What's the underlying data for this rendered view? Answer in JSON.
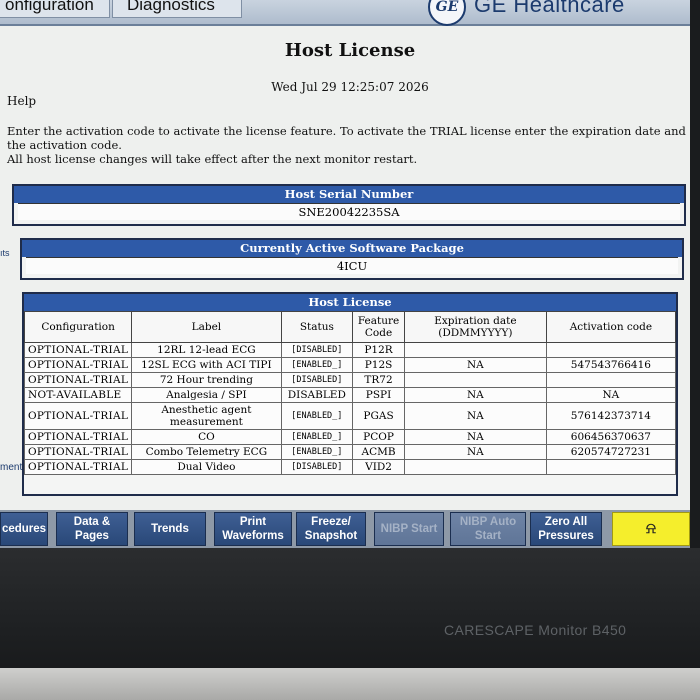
{
  "tabs": [
    {
      "label": "onfiguration"
    },
    {
      "label": "Diagnostics"
    }
  ],
  "brand": {
    "logo": "GE",
    "name": "GE Healthcare"
  },
  "page": {
    "title": "Host License",
    "datetime": "Wed Jul 29 12:25:07 2026",
    "help_label": "Help",
    "instructions": [
      "Enter the activation code to activate the license feature. To activate the TRIAL license enter the expiration date and",
      "the activation code.",
      "All host license changes will take effect after the next monitor restart."
    ]
  },
  "serial": {
    "header": "Host Serial Number",
    "value": "SNE20042235SA"
  },
  "package": {
    "header": "Currently Active Software Package",
    "value": "4ICU"
  },
  "side_labels": {
    "left_1": "ıts",
    "left_2": "ment"
  },
  "license_table": {
    "header": "Host License",
    "columns": [
      "Configuration",
      "Label",
      "Status",
      "Feature Code",
      "Expiration date (DDMMYYYY)",
      "Activation code"
    ],
    "rows": [
      {
        "config": "OPTIONAL-TRIAL",
        "label": "12RL 12-lead ECG",
        "status": "[DISABLED]",
        "code": "P12R",
        "expiration": "",
        "activation": ""
      },
      {
        "config": "OPTIONAL-TRIAL",
        "label": "12SL ECG with ACI TIPI",
        "status": "[ENABLED_]",
        "code": "P12S",
        "expiration": "NA",
        "activation": "547543766416"
      },
      {
        "config": "OPTIONAL-TRIAL",
        "label": "72 Hour trending",
        "status": "[DISABLED]",
        "code": "TR72",
        "expiration": "",
        "activation": ""
      },
      {
        "config": "NOT-AVAILABLE",
        "label": "Analgesia / SPI",
        "status": "DISABLED",
        "code": "PSPI",
        "expiration": "NA",
        "activation": "NA"
      },
      {
        "config": "OPTIONAL-TRIAL",
        "label": "Anesthetic agent measurement",
        "status": "[ENABLED_]",
        "code": "PGAS",
        "expiration": "NA",
        "activation": "576142373714"
      },
      {
        "config": "OPTIONAL-TRIAL",
        "label": "CO",
        "status": "[ENABLED_]",
        "code": "PCOP",
        "expiration": "NA",
        "activation": "606456370637"
      },
      {
        "config": "OPTIONAL-TRIAL",
        "label": "Combo Telemetry ECG",
        "status": "[ENABLED_]",
        "code": "ACMB",
        "expiration": "NA",
        "activation": "620574727231"
      },
      {
        "config": "OPTIONAL-TRIAL",
        "label": "Dual Video",
        "status": "[DISABLED]",
        "code": "VID2",
        "expiration": "",
        "activation": ""
      }
    ]
  },
  "buttons": [
    {
      "label": "cedures",
      "enabled": true
    },
    {
      "label": "Data & Pages",
      "enabled": true
    },
    {
      "label": "Trends",
      "enabled": true
    },
    {
      "label": "Print Waveforms",
      "enabled": true
    },
    {
      "label": "Freeze/ Snapshot",
      "enabled": true
    },
    {
      "label": "NIBP Start",
      "enabled": false
    },
    {
      "label": "NIBP Auto Start",
      "enabled": false
    },
    {
      "label": "Zero All Pressures",
      "enabled": true
    },
    {
      "label": "alarm-silence-icon",
      "enabled": true
    }
  ],
  "device": {
    "model": "CARESCAPE Monitor B450"
  },
  "colors": {
    "header_blue": "#2e5aa8",
    "button_blue": "#294878",
    "alarm_yellow": "#f5ee2c"
  }
}
